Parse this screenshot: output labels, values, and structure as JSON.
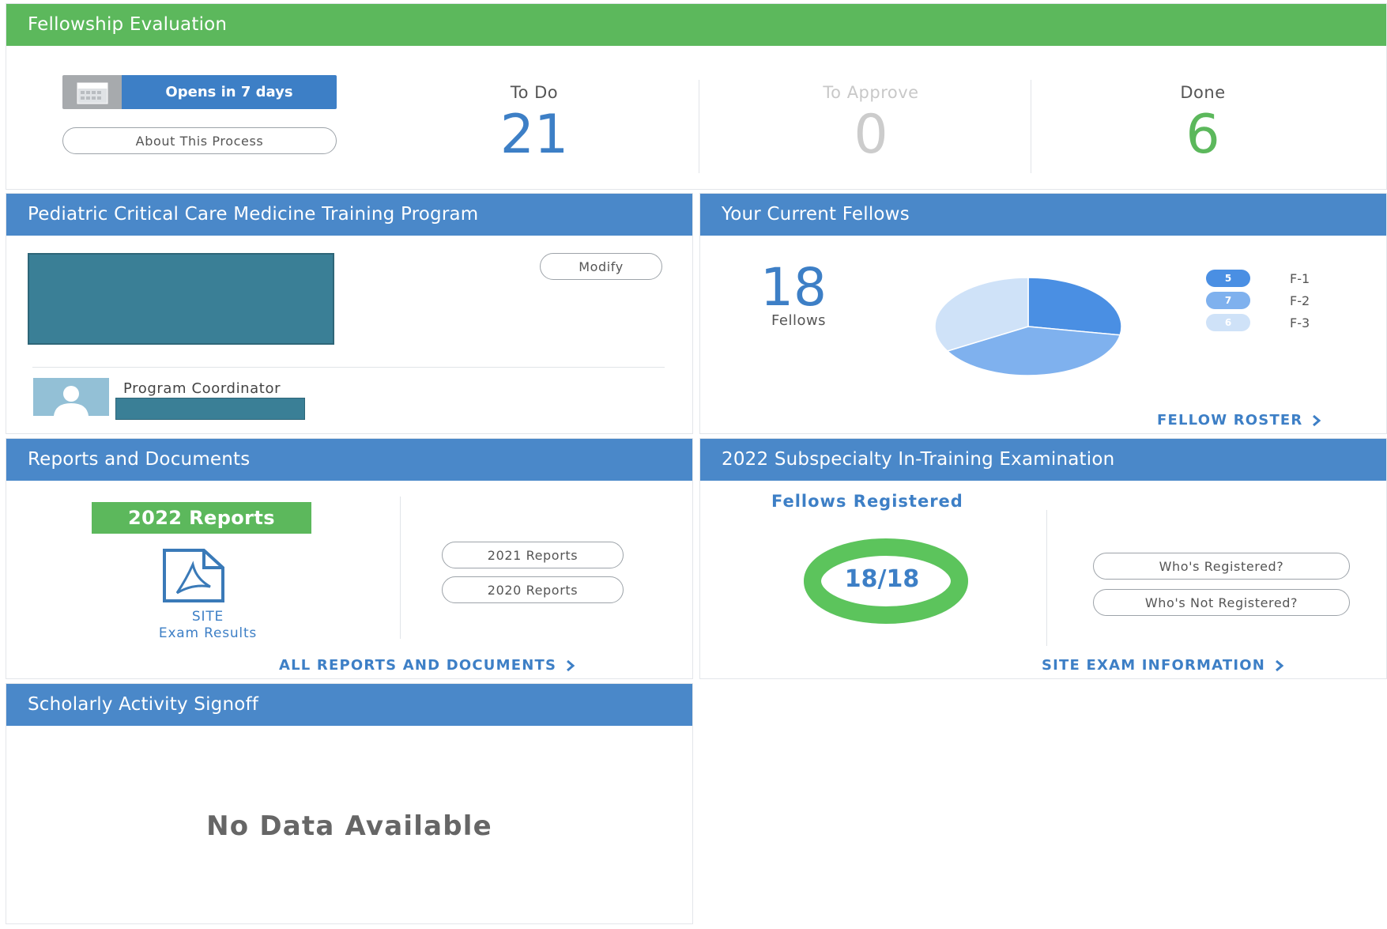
{
  "evaluation": {
    "title": "Fellowship Evaluation",
    "opens_label": "Opens in 7 days",
    "about_label": "About This Process",
    "stats": [
      {
        "label": "To Do",
        "value": "21",
        "color": "#3d7fc6"
      },
      {
        "label": "To Approve",
        "value": "0",
        "color": "#cccccc"
      },
      {
        "label": "Done",
        "value": "6",
        "color": "#5cb85c"
      }
    ]
  },
  "program": {
    "title": "Pediatric Critical Care Medicine Training Program",
    "modify_label": "Modify",
    "coordinator_label": "Program Coordinator"
  },
  "fellows": {
    "title": "Your Current Fellows",
    "count": "18",
    "count_label": "Fellows",
    "roster_link": "FELLOW ROSTER",
    "chart_data": {
      "type": "pie",
      "categories": [
        "F-1",
        "F-2",
        "F-3"
      ],
      "values": [
        5,
        7,
        6
      ],
      "colors": [
        "#4a8fe3",
        "#7fb1ee",
        "#cfe2f8"
      ]
    }
  },
  "reports": {
    "title": "Reports and Documents",
    "current_label": "2022 Reports",
    "pdf_caption_1": "SITE",
    "pdf_caption_2": "Exam Results",
    "btn_2021": "2021 Reports",
    "btn_2020": "2020 Reports",
    "all_link": "ALL REPORTS AND DOCUMENTS"
  },
  "ite": {
    "title": "2022 Subspecialty In-Training Examination",
    "registered_label": "Fellows Registered",
    "registered_value": "18/18",
    "registered_fraction": 1.0,
    "btn_registered": "Who's Registered?",
    "btn_not_registered": "Who's Not Registered?",
    "info_link": "SITE EXAM INFORMATION"
  },
  "scholar": {
    "title": "Scholarly Activity Signoff",
    "empty_text": "No Data Available"
  }
}
